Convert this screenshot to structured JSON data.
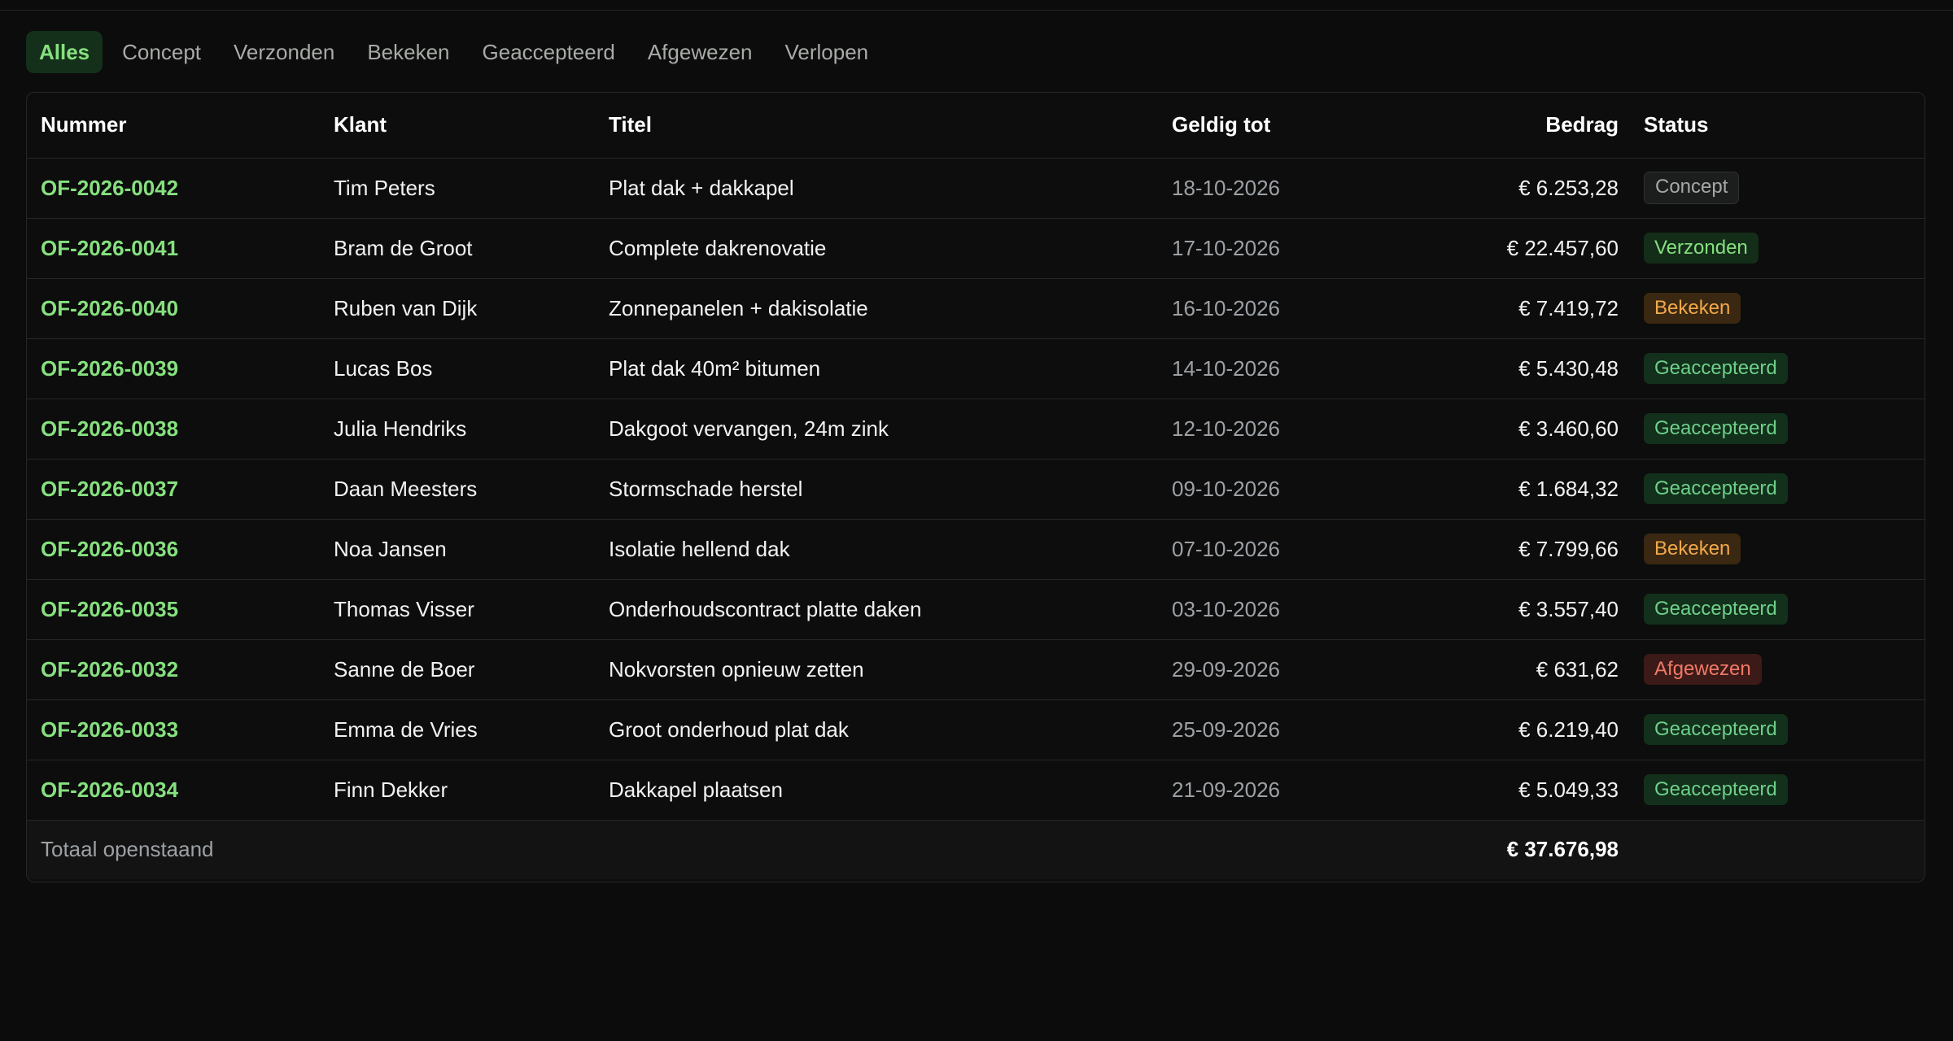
{
  "tabs": [
    {
      "label": "Alles",
      "active": true
    },
    {
      "label": "Concept",
      "active": false
    },
    {
      "label": "Verzonden",
      "active": false
    },
    {
      "label": "Bekeken",
      "active": false
    },
    {
      "label": "Geaccepteerd",
      "active": false
    },
    {
      "label": "Afgewezen",
      "active": false
    },
    {
      "label": "Verlopen",
      "active": false
    }
  ],
  "table": {
    "headers": {
      "nummer": "Nummer",
      "klant": "Klant",
      "titel": "Titel",
      "geldig": "Geldig tot",
      "bedrag": "Bedrag",
      "status": "Status"
    },
    "rows": [
      {
        "nummer": "OF-2026-0042",
        "klant": "Tim Peters",
        "titel": "Plat dak + dakkapel",
        "geldig": "18-10-2026",
        "bedrag": "€ 6.253,28",
        "status": "Concept",
        "status_kind": "concept"
      },
      {
        "nummer": "OF-2026-0041",
        "klant": "Bram de Groot",
        "titel": "Complete dakrenovatie",
        "geldig": "17-10-2026",
        "bedrag": "€ 22.457,60",
        "status": "Verzonden",
        "status_kind": "verzonden"
      },
      {
        "nummer": "OF-2026-0040",
        "klant": "Ruben van Dijk",
        "titel": "Zonnepanelen + dakisolatie",
        "geldig": "16-10-2026",
        "bedrag": "€ 7.419,72",
        "status": "Bekeken",
        "status_kind": "bekeken"
      },
      {
        "nummer": "OF-2026-0039",
        "klant": "Lucas Bos",
        "titel": "Plat dak 40m² bitumen",
        "geldig": "14-10-2026",
        "bedrag": "€ 5.430,48",
        "status": "Geaccepteerd",
        "status_kind": "geaccepteerd"
      },
      {
        "nummer": "OF-2026-0038",
        "klant": "Julia Hendriks",
        "titel": "Dakgoot vervangen, 24m zink",
        "geldig": "12-10-2026",
        "bedrag": "€ 3.460,60",
        "status": "Geaccepteerd",
        "status_kind": "geaccepteerd"
      },
      {
        "nummer": "OF-2026-0037",
        "klant": "Daan Meesters",
        "titel": "Stormschade herstel",
        "geldig": "09-10-2026",
        "bedrag": "€ 1.684,32",
        "status": "Geaccepteerd",
        "status_kind": "geaccepteerd"
      },
      {
        "nummer": "OF-2026-0036",
        "klant": "Noa Jansen",
        "titel": "Isolatie hellend dak",
        "geldig": "07-10-2026",
        "bedrag": "€ 7.799,66",
        "status": "Bekeken",
        "status_kind": "bekeken"
      },
      {
        "nummer": "OF-2026-0035",
        "klant": "Thomas Visser",
        "titel": "Onderhoudscontract platte daken",
        "geldig": "03-10-2026",
        "bedrag": "€ 3.557,40",
        "status": "Geaccepteerd",
        "status_kind": "geaccepteerd"
      },
      {
        "nummer": "OF-2026-0032",
        "klant": "Sanne de Boer",
        "titel": "Nokvorsten opnieuw zetten",
        "geldig": "29-09-2026",
        "bedrag": "€ 631,62",
        "status": "Afgewezen",
        "status_kind": "afgewezen"
      },
      {
        "nummer": "OF-2026-0033",
        "klant": "Emma de Vries",
        "titel": "Groot onderhoud plat dak",
        "geldig": "25-09-2026",
        "bedrag": "€ 6.219,40",
        "status": "Geaccepteerd",
        "status_kind": "geaccepteerd"
      },
      {
        "nummer": "OF-2026-0034",
        "klant": "Finn Dekker",
        "titel": "Dakkapel plaatsen",
        "geldig": "21-09-2026",
        "bedrag": "€ 5.049,33",
        "status": "Geaccepteerd",
        "status_kind": "geaccepteerd"
      }
    ],
    "footer": {
      "label": "Totaal openstaand",
      "total": "€ 37.676,98"
    }
  },
  "colors": {
    "accent_green": "#86e07f",
    "background": "#0b0c0b",
    "muted_text": "#9da1a6"
  }
}
